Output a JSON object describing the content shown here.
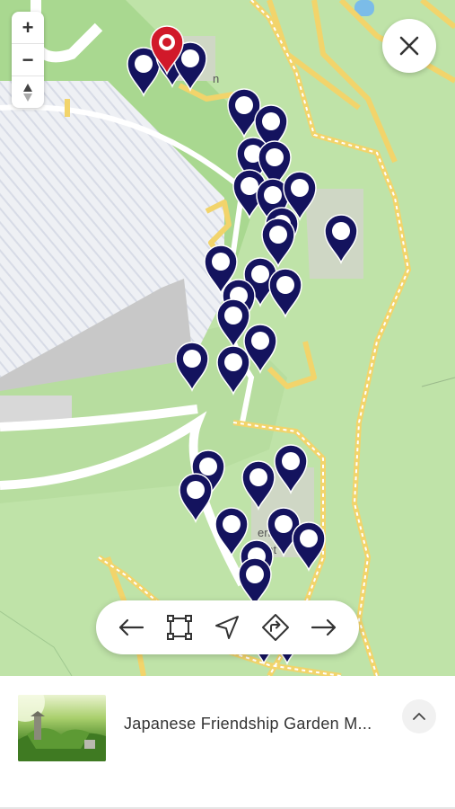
{
  "map": {
    "zoom_in_label": "+",
    "zoom_out_label": "−",
    "compass_icon": "compass-icon",
    "labels": [
      {
        "text": "n"
      },
      {
        "text": "en S"
      },
      {
        "text": "ent"
      }
    ],
    "pin_color": "#14135e",
    "selected_pin_color": "#d1192a",
    "pin_count": 41
  },
  "close_button": {
    "icon": "close-icon"
  },
  "toolbar": {
    "buttons": [
      {
        "name": "previous",
        "icon": "arrow-left-icon"
      },
      {
        "name": "select-area",
        "icon": "select-area-icon"
      },
      {
        "name": "locate",
        "icon": "navigation-icon"
      },
      {
        "name": "directions",
        "icon": "directions-icon"
      },
      {
        "name": "next",
        "icon": "arrow-right-icon"
      }
    ]
  },
  "place_card": {
    "title": "Japanese Friendship Garden M...",
    "expand_icon": "chevron-up-icon"
  }
}
